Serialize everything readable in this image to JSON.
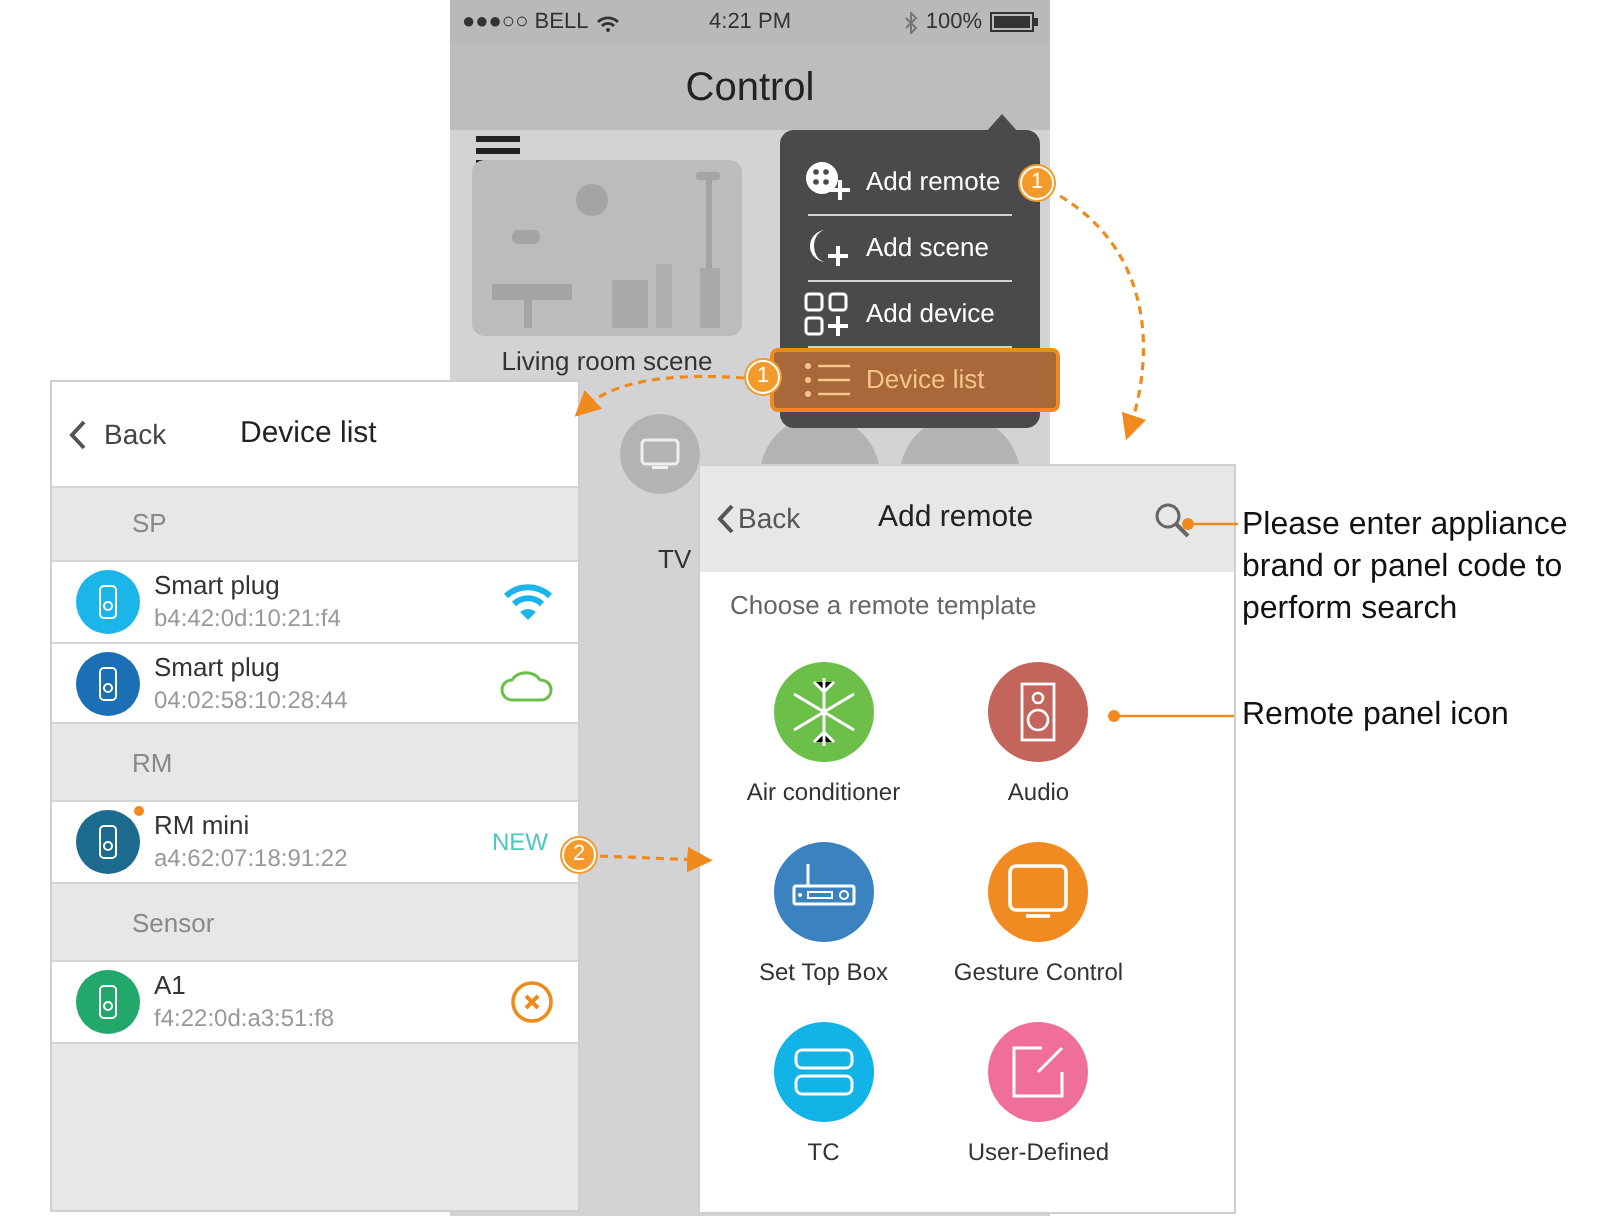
{
  "background_screen": {
    "status_bar": {
      "carrier": "●●●○○ BELL",
      "time": "4:21 PM",
      "battery": "100%"
    },
    "title": "Control",
    "scene": {
      "label": "Living room scene"
    },
    "devices": [
      {
        "label": "TV"
      }
    ]
  },
  "popup_menu": {
    "items": [
      {
        "label": "Add remote",
        "kind": "remote",
        "selected": false,
        "callout": "1"
      },
      {
        "label": "Add scene",
        "kind": "scene",
        "selected": false
      },
      {
        "label": "Add device",
        "kind": "device",
        "selected": false
      },
      {
        "label": "Device list",
        "kind": "list",
        "selected": true,
        "callout": "1"
      }
    ]
  },
  "device_list": {
    "back": "Back",
    "title": "Device list",
    "groups": [
      {
        "name": "SP",
        "devices": [
          {
            "name": "Smart plug",
            "mac": "b4:42:0d:10:21:f4",
            "color": "#1bb5ea",
            "unread": false,
            "status": {
              "kind": "wifi"
            }
          },
          {
            "name": "Smart plug",
            "mac": "04:02:58:10:28:44",
            "color": "#1a6fb5",
            "unread": false,
            "status": {
              "kind": "cloud"
            }
          }
        ]
      },
      {
        "name": "RM",
        "devices": [
          {
            "name": "RM mini",
            "mac": "a4:62:07:18:91:22",
            "color": "#1c6b8e",
            "unread": true,
            "status": {
              "kind": "text",
              "text": "NEW"
            },
            "callout": "2"
          }
        ]
      },
      {
        "name": "Sensor",
        "devices": [
          {
            "name": "A1",
            "mac": "f4:22:0d:a3:51:f8",
            "color": "#22a86a",
            "unread": false,
            "status": {
              "kind": "offline"
            }
          }
        ]
      }
    ]
  },
  "add_remote": {
    "back": "Back",
    "title": "Add remote",
    "subtitle": "Choose a remote template",
    "templates": [
      {
        "label": "Air conditioner",
        "kind": "snow",
        "color": "#6cc04a"
      },
      {
        "label": "Audio",
        "kind": "speaker",
        "color": "#c4655c"
      },
      {
        "label": "Set Top Box",
        "kind": "box",
        "color": "#3b83c0"
      },
      {
        "label": "Gesture Control",
        "kind": "screen",
        "color": "#f28a22"
      },
      {
        "label": "TC",
        "kind": "switch",
        "color": "#12b4e8"
      },
      {
        "label": "User-Defined",
        "kind": "edit",
        "color": "#ef6f98"
      }
    ]
  },
  "annotations": [
    {
      "text": "Please enter appliance brand or panel code to perform search"
    },
    {
      "text": "Remote panel icon"
    }
  ]
}
